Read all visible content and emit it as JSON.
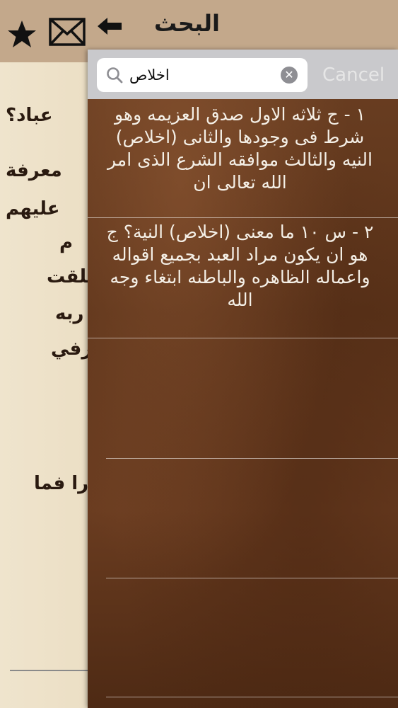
{
  "topbar": {
    "title": "البحث",
    "icons": [
      "star-icon",
      "mail-icon",
      "back-arrow-icon"
    ]
  },
  "page": {
    "lines": [
      "عباد؟",
      "معرفة",
      "عليهم",
      "م",
      "خلقت",
      "ربه",
      "رفي",
      "را فما"
    ]
  },
  "search": {
    "query": "اخلاص",
    "cancel_label": "Cancel"
  },
  "results": [
    {
      "text": "١ - ج   ثلاثه  الاول صدق العزيمه وهو شرط فى وجودها  والثانى (اخلاص) النيه  والثالث موافقه الشرع الذى امر الله تعالى ان"
    },
    {
      "text": "٢ - س ١٠   ما معنى (اخلاص) النية؟  ج   هو ان يكون مراد العبد بجميع اقواله واعماله الظاهره والباطنه ابتغاء وجه الله"
    }
  ],
  "colors": {
    "topbar": "#c3a88b",
    "panel": "#5a3219",
    "search_bar": "#c9c9cc"
  }
}
